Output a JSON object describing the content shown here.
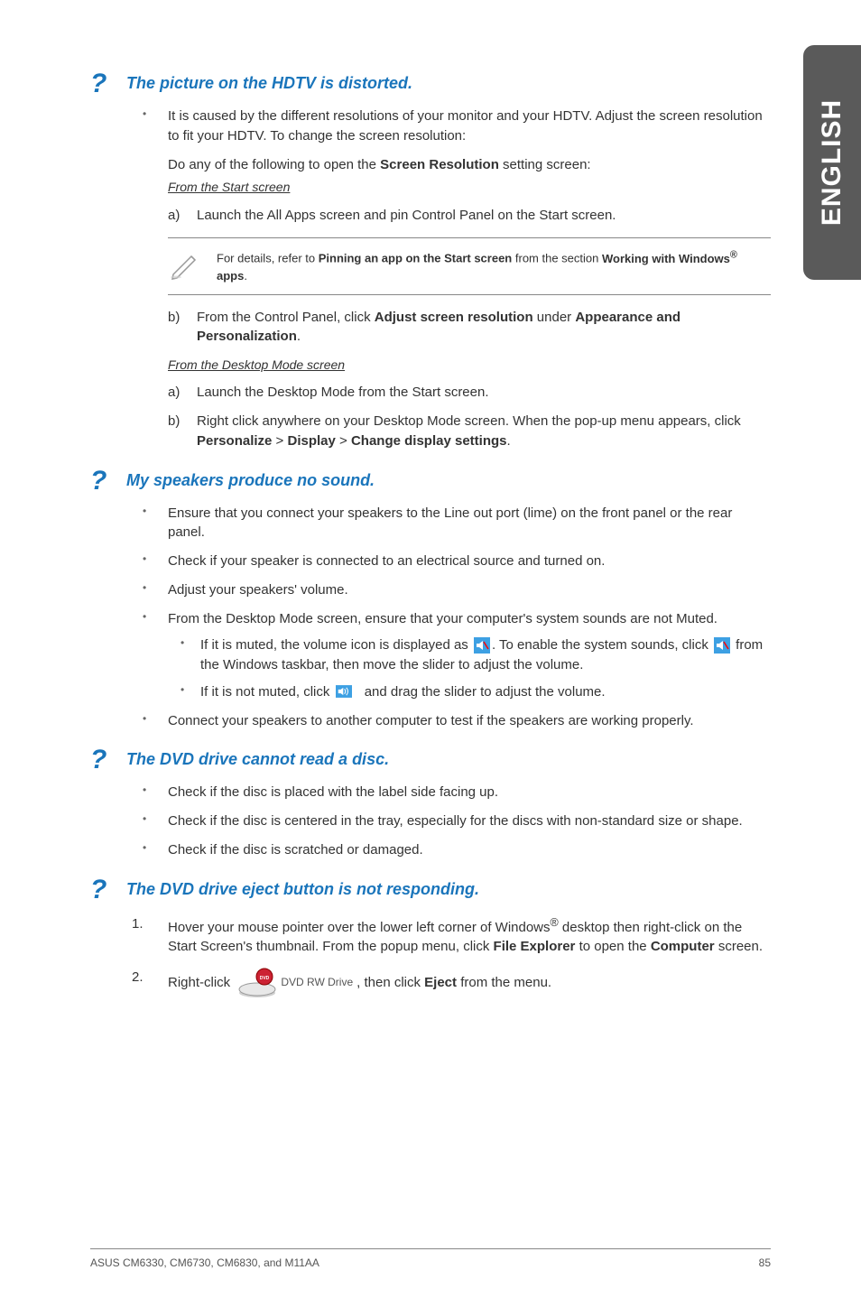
{
  "side_tab": "ENGLISH",
  "q1": {
    "title": "The picture on the HDTV is distorted.",
    "bullet1_line1": "It is caused by the different resolutions of your monitor and your HDTV. Adjust the screen resolution to fit your HDTV. To change the screen resolution:",
    "do_any_prefix": "Do any of the following to open the ",
    "do_any_bold": "Screen Resolution",
    "do_any_suffix": " setting screen:",
    "from_start": "From the Start screen",
    "a_label": "a)",
    "a_text": "Launch the All Apps screen and pin Control Panel on the Start screen.",
    "note_prefix": "For details, refer to ",
    "note_bold1": "Pinning an app on the Start screen",
    "note_mid": " from the section ",
    "note_bold2_a": "Working with Windows",
    "note_sup": "®",
    "note_bold2_b": " apps",
    "note_end": ".",
    "b_label": "b)",
    "b_pre": "From the Control Panel, click ",
    "b_bold1": "Adjust screen resolution",
    "b_mid": " under ",
    "b_bold2": "Appearance and Personalization",
    "b_end": ".",
    "from_desktop": "From the Desktop Mode screen",
    "d_a_label": "a)",
    "d_a_text": "Launch the Desktop Mode from the Start screen.",
    "d_b_label": "b)",
    "d_b_pre": "Right click anywhere on your Desktop Mode screen. When the pop-up menu appears, click ",
    "d_b_b1": "Personalize",
    "d_b_gt1": " > ",
    "d_b_b2": "Display",
    "d_b_gt2": " > ",
    "d_b_b3": "Change display settings",
    "d_b_end": "."
  },
  "q2": {
    "title": "My speakers produce no sound.",
    "it1": "Ensure that you connect your speakers to the Line out port (lime) on the front panel or the rear panel.",
    "it2": "Check if your speaker is connected to an electrical source and turned on.",
    "it3": "Adjust your speakers' volume.",
    "it4": "From the Desktop Mode screen, ensure that your computer's system sounds are not Muted.",
    "s1_pre": "If it is muted, the volume icon is displayed as ",
    "s1_mid": ". To enable the system sounds, click ",
    "s1_post": " from the Windows taskbar, then move the slider to adjust the volume.",
    "s2_pre": "If it is not muted, click ",
    "s2_post": " and drag the slider to adjust the volume.",
    "it5": "Connect your speakers to another computer to test if the speakers are working properly."
  },
  "q3": {
    "title": "The DVD drive cannot read a disc.",
    "it1": "Check if the disc is placed with the label side facing up.",
    "it2": "Check if the disc is centered in the tray, especially for the discs with non-standard size or shape.",
    "it3": "Check if the disc is scratched or damaged."
  },
  "q4": {
    "title": "The DVD drive eject button is not responding.",
    "n1_label": "1.",
    "n1_pre": "Hover your mouse pointer over the lower left corner of Windows",
    "n1_sup": "®",
    "n1_mid": " desktop then right-click on the Start Screen's thumbnail. From the popup menu, click ",
    "n1_b1": "File Explorer",
    "n1_mid2": " to open the ",
    "n1_b2": "Computer",
    "n1_end": " screen.",
    "n2_label": "2.",
    "n2_pre": "Right-click ",
    "n2_dvd_label": "DVD RW Drive",
    "n2_mid": ", then click ",
    "n2_b1": "Eject",
    "n2_end": " from the menu."
  },
  "footer_left": "ASUS CM6330, CM6730, CM6830, and M11AA",
  "footer_right": "85"
}
